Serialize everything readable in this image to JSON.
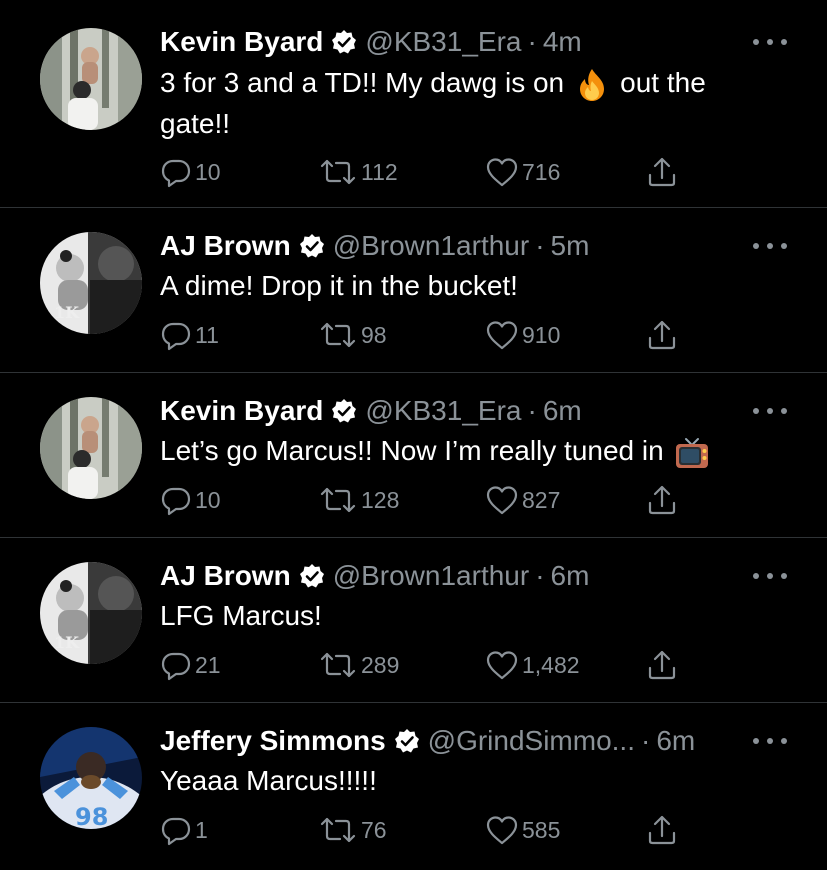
{
  "tweets": [
    {
      "name": "Kevin Byard",
      "handle": "@KB31_Era",
      "time": "4m",
      "text_before": "3 for 3 and a TD!! My dawg is on",
      "emoji": "fire-emoji",
      "text_after": "out the gate!!",
      "replies": "10",
      "retweets": "112",
      "likes": "716"
    },
    {
      "name": "AJ Brown",
      "handle": "@Brown1arthur",
      "time": "5m",
      "text": "A dime! Drop it in the bucket!",
      "replies": "11",
      "retweets": "98",
      "likes": "910"
    },
    {
      "name": "Kevin Byard",
      "handle": "@KB31_Era",
      "time": "6m",
      "text_before": "Let’s go Marcus!! Now I’m really tuned in",
      "emoji": "television-emoji",
      "replies": "10",
      "retweets": "128",
      "likes": "827"
    },
    {
      "name": "AJ Brown",
      "handle": "@Brown1arthur",
      "time": "6m",
      "text": "LFG Marcus!",
      "replies": "21",
      "retweets": "289",
      "likes": "1,482"
    },
    {
      "name": "Jeffery Simmons",
      "handle": "@GrindSimmo...",
      "time": "6m",
      "text": "Yeaaa Marcus!!!!!",
      "replies": "1",
      "retweets": "76",
      "likes": "585"
    }
  ],
  "separator": "·",
  "colors": {
    "background": "#000000",
    "secondary_text": "#8b9298",
    "divider": "#2f3336",
    "verified_badge": "#ffffff"
  },
  "icons": [
    "reply-icon",
    "retweet-icon",
    "like-icon",
    "share-icon",
    "more-icon",
    "verified-badge-icon"
  ]
}
